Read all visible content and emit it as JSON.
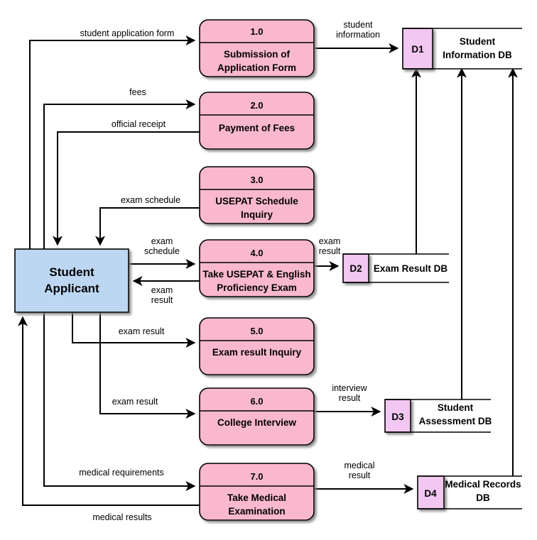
{
  "diagram": {
    "type": "data-flow-diagram",
    "title": "",
    "colors": {
      "process_fill": "#f9b8cd",
      "external_entity_fill": "#bdd7f2",
      "datastore_key_fill": "#f2c7f2",
      "datastore_body_fill": "#ffffff",
      "line": "#000000",
      "background": "#ffffff"
    }
  },
  "external_entities": [
    {
      "id": "E1",
      "label_line1": "Student",
      "label_line2": "Applicant"
    }
  ],
  "processes": [
    {
      "id": "P1",
      "number": "1.0",
      "name_line1": "Submission of",
      "name_line2": "Application Form"
    },
    {
      "id": "P2",
      "number": "2.0",
      "name_line1": "Payment of Fees",
      "name_line2": ""
    },
    {
      "id": "P3",
      "number": "3.0",
      "name_line1": "USEPAT Schedule",
      "name_line2": "Inquiry"
    },
    {
      "id": "P4",
      "number": "4.0",
      "name_line1": "Take USEPAT & English",
      "name_line2": "Proficiency Exam"
    },
    {
      "id": "P5",
      "number": "5.0",
      "name_line1": "Exam result Inquiry",
      "name_line2": ""
    },
    {
      "id": "P6",
      "number": "6.0",
      "name_line1": "College Interview",
      "name_line2": ""
    },
    {
      "id": "P7",
      "number": "7.0",
      "name_line1": "Take Medical",
      "name_line2": "Examination"
    }
  ],
  "data_stores": [
    {
      "id": "D1",
      "key": "D1",
      "name_line1": "Student",
      "name_line2": "Information DB"
    },
    {
      "id": "D2",
      "key": "D2",
      "name_line1": "Exam Result DB",
      "name_line2": ""
    },
    {
      "id": "D3",
      "key": "D3",
      "name_line1": "Student",
      "name_line2": "Assessment DB"
    },
    {
      "id": "D4",
      "key": "D4",
      "name_line1": "Medical Records",
      "name_line2": "DB"
    }
  ],
  "flows": [
    {
      "id": "F1",
      "label_line1": "student application form",
      "label_line2": "",
      "from": "Student Applicant",
      "to": "1.0"
    },
    {
      "id": "F2",
      "label_line1": "student",
      "label_line2": "information",
      "from": "1.0",
      "to": "D1"
    },
    {
      "id": "F3",
      "label_line1": "fees",
      "label_line2": "",
      "from": "Student Applicant",
      "to": "2.0"
    },
    {
      "id": "F4",
      "label_line1": "official receipt",
      "label_line2": "",
      "from": "2.0",
      "to": "Student Applicant"
    },
    {
      "id": "F5",
      "label_line1": "exam schedule",
      "label_line2": "",
      "from": "3.0",
      "to": "Student Applicant"
    },
    {
      "id": "F6",
      "label_line1": "exam",
      "label_line2": "schedule",
      "from": "Student Applicant",
      "to": "4.0"
    },
    {
      "id": "F7",
      "label_line1": "exam",
      "label_line2": "result",
      "from": "4.0",
      "to": "Student Applicant"
    },
    {
      "id": "F8",
      "label_line1": "exam",
      "label_line2": "result",
      "from": "4.0",
      "to": "D2"
    },
    {
      "id": "F9",
      "label_line1": "exam result",
      "label_line2": "",
      "from": "Student Applicant",
      "to": "5.0"
    },
    {
      "id": "F10",
      "label_line1": "exam result",
      "label_line2": "",
      "from": "Student Applicant",
      "to": "6.0"
    },
    {
      "id": "F11",
      "label_line1": "interview",
      "label_line2": "result",
      "from": "6.0",
      "to": "D3"
    },
    {
      "id": "F12",
      "label_line1": "medical requirements",
      "label_line2": "",
      "from": "Student Applicant",
      "to": "7.0"
    },
    {
      "id": "F13",
      "label_line1": "medical",
      "label_line2": "result",
      "from": "7.0",
      "to": "D4"
    },
    {
      "id": "F14",
      "label_line1": "medical results",
      "label_line2": "",
      "from": "7.0",
      "to": "Student Applicant"
    },
    {
      "id": "F15",
      "label_line1": "",
      "label_line2": "",
      "from": "D2",
      "to": "D1"
    },
    {
      "id": "F16",
      "label_line1": "",
      "label_line2": "",
      "from": "D3",
      "to": "D1"
    },
    {
      "id": "F17",
      "label_line1": "",
      "label_line2": "",
      "from": "D4",
      "to": "D1"
    }
  ]
}
